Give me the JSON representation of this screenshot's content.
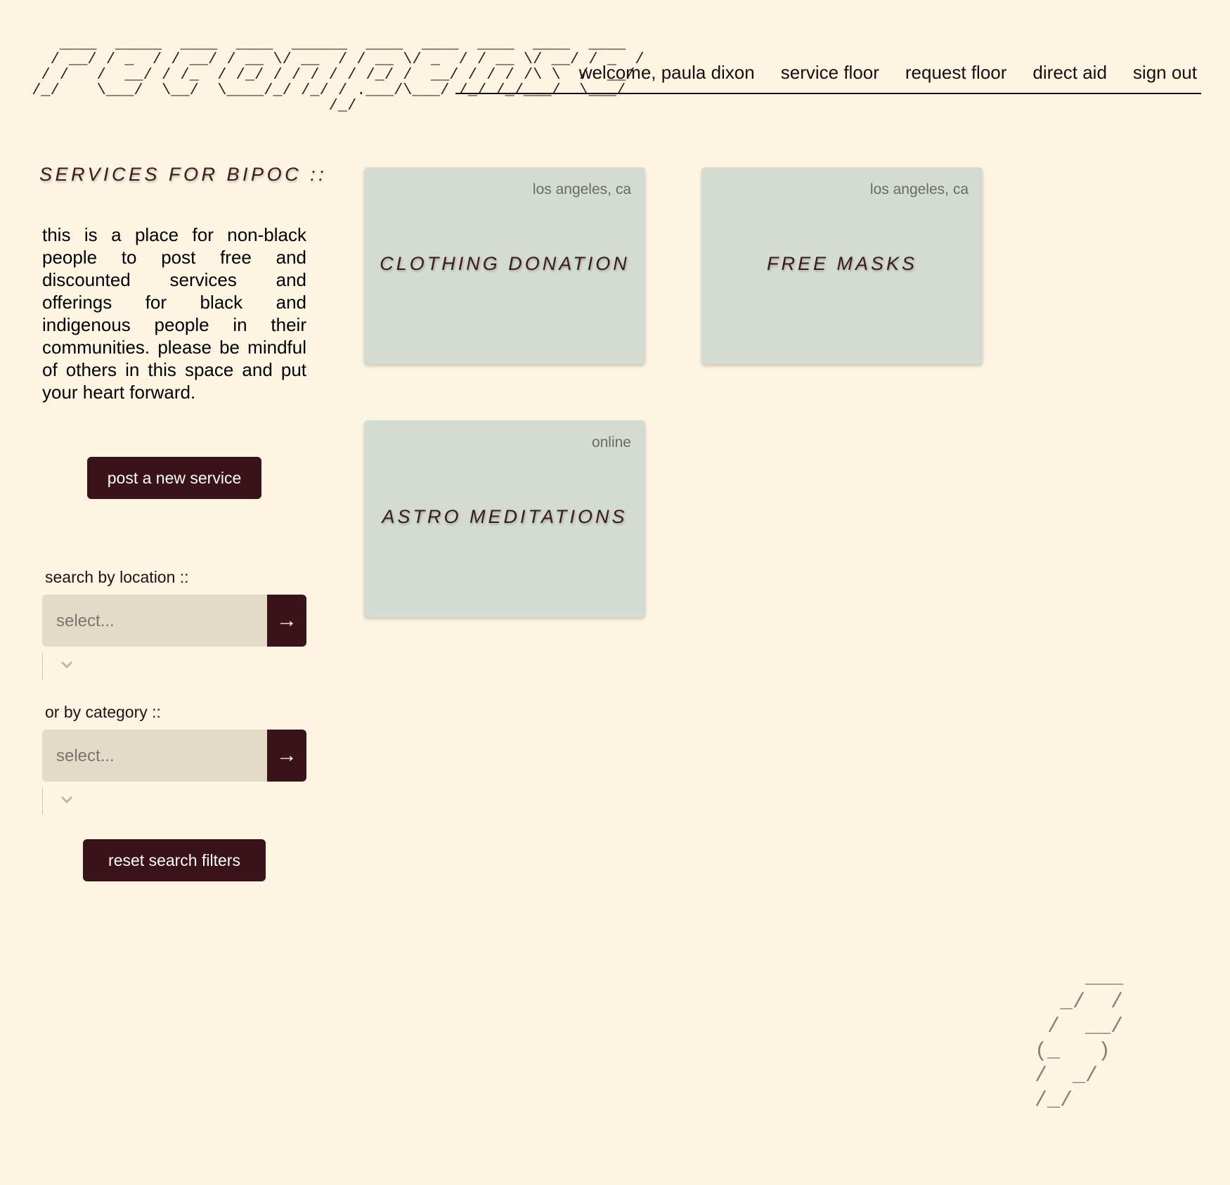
{
  "header": {
    "logo_art": "    ____  _____  ____  ____  ______  ____  ____  ____  ____  ____\n   / __/ / _  / / __/ / __ \\/ __  / / __ \\/ _  / / __ \\/ __/ / _  /\n  / /   /  __/ / /_  / /_/ / / / / / /_/ /  __/ / / / /\\ \\  /  __/\n /_/    \\___/  \\__/  \\____/_/ /_/ / .___/\\___/ /_/ /_/___/  \\___/\n                                 /_/",
    "nav": {
      "welcome": "welcome, paula dixon",
      "service_floor": "service floor",
      "request_floor": "request floor",
      "direct_aid": "direct aid",
      "sign_out": "sign out"
    }
  },
  "sidebar": {
    "title": "SERVICES FOR BIPOC ::",
    "intro": "this is a place for non-black people to post free and discounted services and offerings for black and indigenous people in their communities. please be mindful of others in this space and put your heart forward.",
    "post_button": "post a new service",
    "location_label": "search by location ::",
    "location_placeholder": "select...",
    "category_label": "or by category ::",
    "category_placeholder": "select...",
    "go_arrow": "→",
    "reset_button": "reset search filters"
  },
  "services": [
    {
      "location": "los angeles, ca",
      "title": "CLOTHING DONATION"
    },
    {
      "location": "los angeles, ca",
      "title": "FREE MASKS"
    },
    {
      "location": "online",
      "title": "ASTRO MEDITATIONS"
    }
  ],
  "decoration": {
    "art": "    ___\n  _/  /\n /  __/\n(_   )\n/  _/\n/_/"
  },
  "colors": {
    "background": "#fdf4e1",
    "accent": "#3a121a",
    "card": "#d4dbd1",
    "select": "#e3dac8"
  }
}
